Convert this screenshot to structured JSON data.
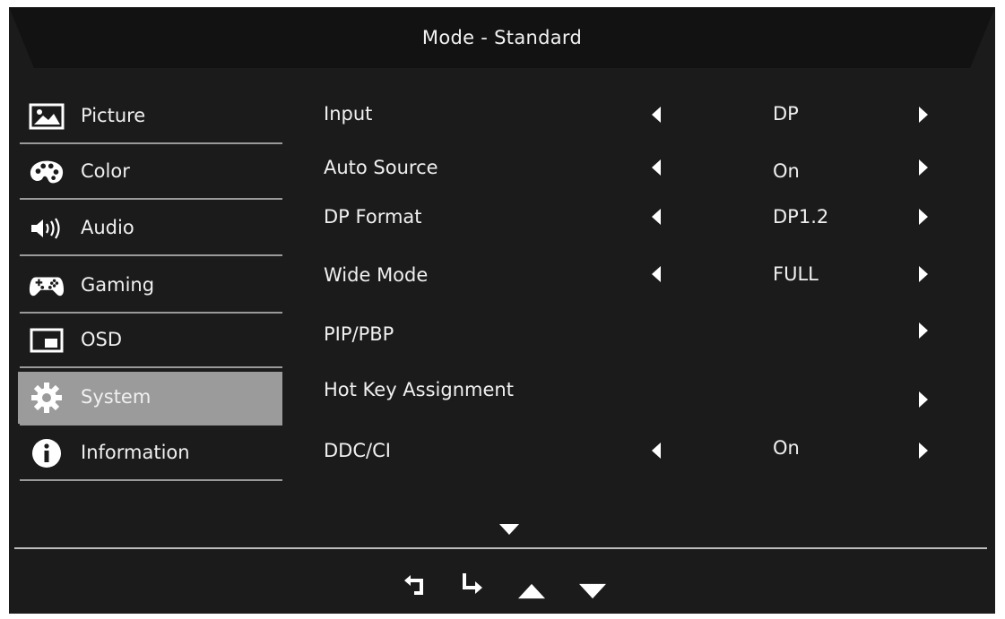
{
  "window": {
    "title": "Mode - Standard"
  },
  "sidebar": {
    "items": [
      {
        "label": "Picture",
        "icon": "picture-icon",
        "active": false
      },
      {
        "label": "Color",
        "icon": "palette-icon",
        "active": false
      },
      {
        "label": "Audio",
        "icon": "speaker-icon",
        "active": false
      },
      {
        "label": "Gaming",
        "icon": "gamepad-icon",
        "active": false
      },
      {
        "label": "OSD",
        "icon": "osd-window-icon",
        "active": false
      },
      {
        "label": "System",
        "icon": "gear-icon",
        "active": true
      },
      {
        "label": "Information",
        "icon": "info-icon",
        "active": false
      }
    ]
  },
  "settings": {
    "rows": [
      {
        "name": "Input",
        "value": "DP",
        "has_left": true,
        "has_right": true
      },
      {
        "name": "Auto Source",
        "value": "On",
        "has_left": true,
        "has_right": true
      },
      {
        "name": "DP Format",
        "value": "DP1.2",
        "has_left": true,
        "has_right": true
      },
      {
        "name": "Wide Mode",
        "value": "FULL",
        "has_left": true,
        "has_right": true
      },
      {
        "name": "PIP/PBP",
        "value": "",
        "has_left": false,
        "has_right": true
      },
      {
        "name": "Hot Key Assignment",
        "value": "",
        "has_left": false,
        "has_right": true
      },
      {
        "name": "DDC/CI",
        "value": "On",
        "has_left": true,
        "has_right": true
      }
    ]
  },
  "navigation": {
    "buttons": [
      "back-arrow-icon",
      "enter-arrow-icon",
      "up-triangle-icon",
      "down-triangle-icon"
    ]
  },
  "colors": {
    "background": "#1b1b1b",
    "active_item": "#9b9b9b",
    "separator": "#9a9a9a",
    "text": "#f0f0f0"
  }
}
